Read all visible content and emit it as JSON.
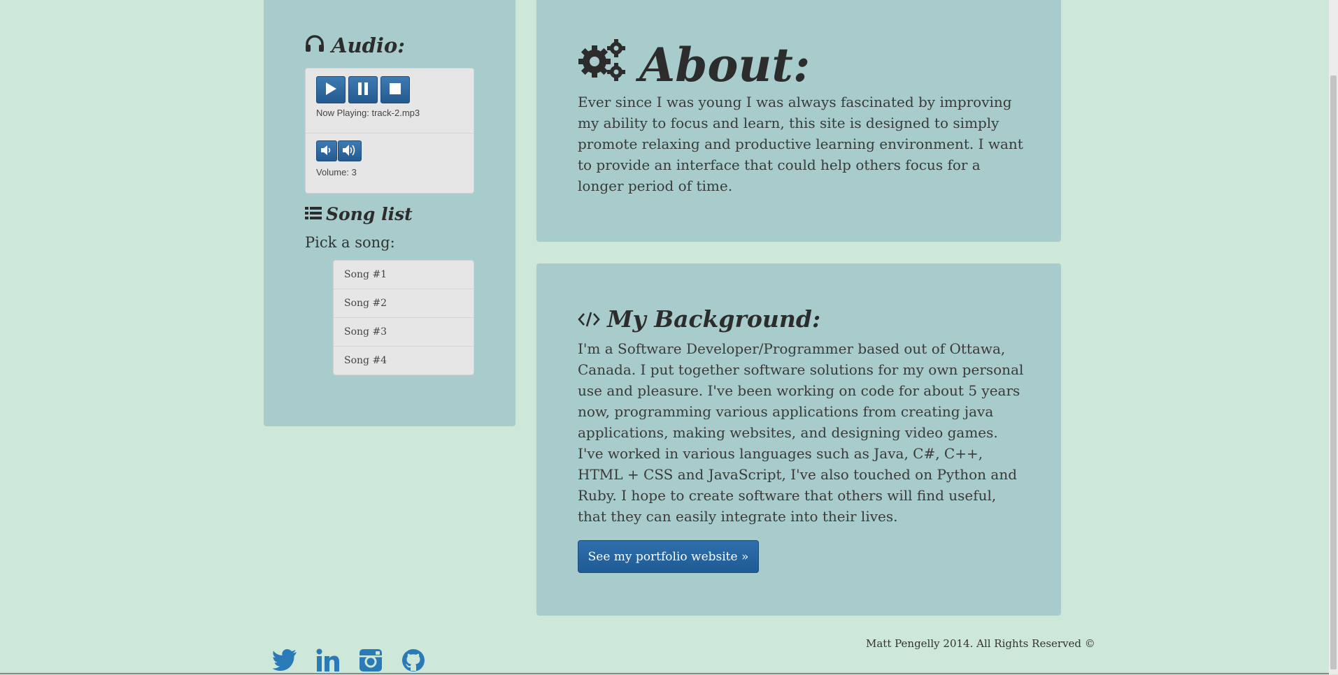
{
  "audio": {
    "title": "Audio:",
    "icon": "headphones-icon",
    "controls": [
      "play-icon",
      "pause-icon",
      "stop-icon"
    ],
    "now_playing": "Now Playing: track-2.mp3",
    "volume": "Volume: 3"
  },
  "songlist": {
    "title": "Song list",
    "pick_label": "Pick a song:",
    "songs": [
      "Song #1",
      "Song #2",
      "Song #3",
      "Song #4"
    ]
  },
  "about": {
    "title": "About:",
    "text": "Ever since I was young I was always fascinated by improving my ability to focus and learn, this site is designed to simply promote relaxing and productive learning environment. I want to provide an interface that could help others focus for a longer period of time."
  },
  "background": {
    "title": "My Background:",
    "text": "I'm a Software Developer/Programmer based out of Ottawa, Canada. I put together software solutions for my own personal use and pleasure. I've been working on code for about 5 years now, programming various applications from creating java applications, making websites, and designing video games. I've worked in various languages such as Java, C#, C++, HTML + CSS and JavaScript, I've also touched on Python and Ruby. I hope to create software that others will find useful, that they can easily integrate into their lives.",
    "button": "See my portfolio website »"
  },
  "footer": {
    "copyright": "Matt Pengelly 2014. All Rights Reserved ©",
    "social": [
      "twitter-icon",
      "linkedin-icon",
      "instagram-icon",
      "github-icon"
    ]
  },
  "colors": {
    "background": "#cde7d8",
    "panel": "#a7cccb",
    "accent": "#2a67a2"
  }
}
